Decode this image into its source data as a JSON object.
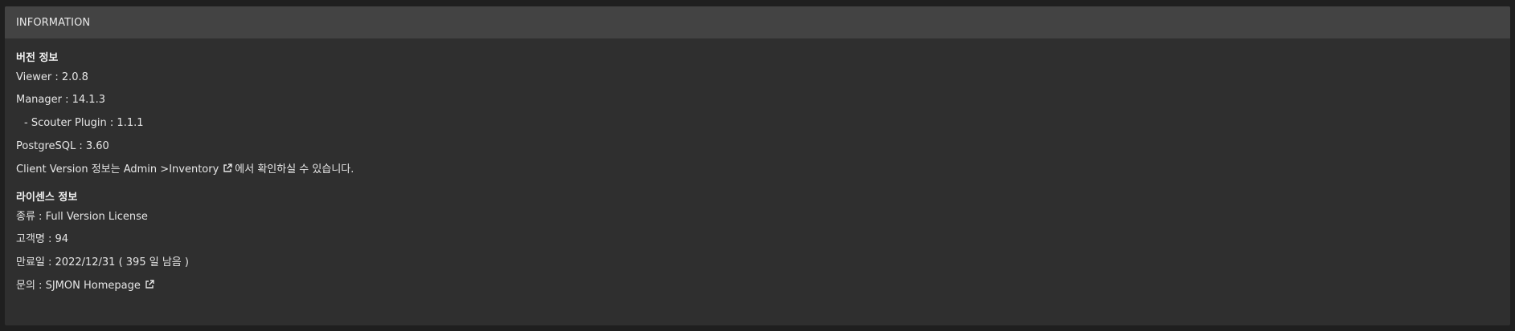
{
  "panel": {
    "title": "INFORMATION"
  },
  "version": {
    "heading": "버전 정보",
    "viewer": "Viewer : 2.0.8",
    "manager": "Manager : 14.1.3",
    "scouter_plugin": "- Scouter Plugin : 1.1.1",
    "postgresql": "PostgreSQL : 3.60",
    "client_prefix": "Client Version 정보는 Admin >",
    "client_link": "Inventory",
    "client_suffix": "에서 확인하실 수 있습니다."
  },
  "license": {
    "heading": "라이센스 정보",
    "type": "종류 : Full Version License",
    "customer": "고객명 : 94",
    "expiry": "만료일 : 2022/12/31 ( 395 일 남음 )",
    "contact_prefix": "문의 : ",
    "contact_link": "SJMON Homepage"
  },
  "icons": {
    "external_link": "external-link-icon"
  }
}
